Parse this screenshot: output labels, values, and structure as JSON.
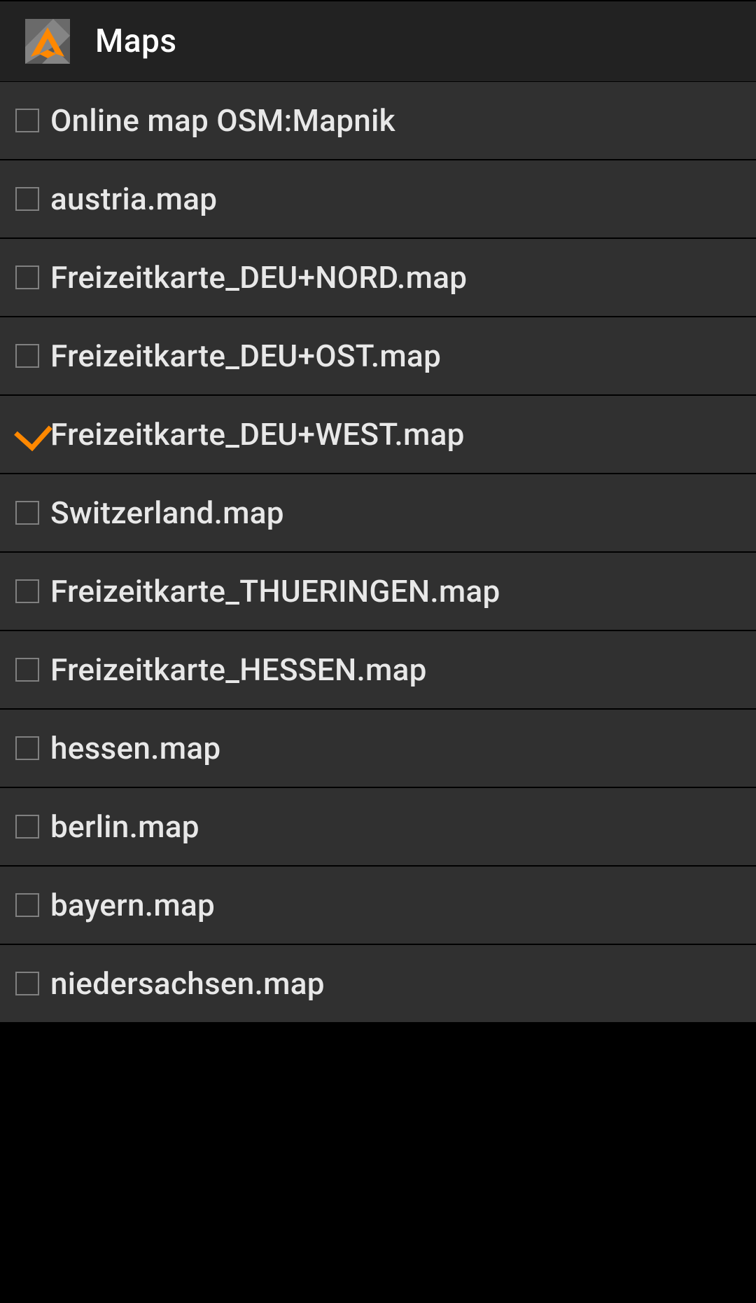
{
  "header": {
    "title": "Maps"
  },
  "maps": [
    {
      "label": "Online map OSM:Mapnik",
      "checked": false
    },
    {
      "label": "austria.map",
      "checked": false
    },
    {
      "label": "Freizeitkarte_DEU+NORD.map",
      "checked": false
    },
    {
      "label": "Freizeitkarte_DEU+OST.map",
      "checked": false
    },
    {
      "label": "Freizeitkarte_DEU+WEST.map",
      "checked": true
    },
    {
      "label": "Switzerland.map",
      "checked": false
    },
    {
      "label": "Freizeitkarte_THUERINGEN.map",
      "checked": false
    },
    {
      "label": "Freizeitkarte_HESSEN.map",
      "checked": false
    },
    {
      "label": "hessen.map",
      "checked": false
    },
    {
      "label": "berlin.map",
      "checked": false
    },
    {
      "label": "bayern.map",
      "checked": false
    },
    {
      "label": "niedersachsen.map",
      "checked": false
    }
  ]
}
